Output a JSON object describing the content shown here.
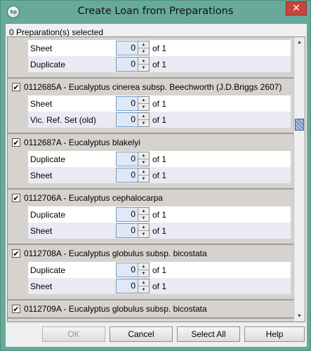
{
  "window": {
    "title": "Create Loan from Preparations",
    "app_icon_text": "Sp",
    "close_glyph": "✕"
  },
  "status": {
    "selected_text": "0 Preparation(s) selected"
  },
  "groups": [
    {
      "checked": true,
      "label": "",
      "rows": [
        {
          "type": "Sheet",
          "value": "0",
          "of": "of 1"
        },
        {
          "type": "Duplicate",
          "value": "0",
          "of": "of 1"
        }
      ]
    },
    {
      "checked": true,
      "label": "0112685A - Eucalyptus cinerea subsp. Beechworth (J.D.Briggs 2607)",
      "rows": [
        {
          "type": "Sheet",
          "value": "0",
          "of": "of 1"
        },
        {
          "type": "Vic. Ref. Set (old)",
          "value": "0",
          "of": "of 1"
        }
      ]
    },
    {
      "checked": true,
      "label": "0112687A - Eucalyptus blakelyi",
      "rows": [
        {
          "type": "Duplicate",
          "value": "0",
          "of": "of 1"
        },
        {
          "type": "Sheet",
          "value": "0",
          "of": "of 1"
        }
      ]
    },
    {
      "checked": true,
      "label": "0112706A - Eucalyptus cephalocarpa",
      "rows": [
        {
          "type": "Duplicate",
          "value": "0",
          "of": "of 1"
        },
        {
          "type": "Sheet",
          "value": "0",
          "of": "of 1"
        }
      ]
    },
    {
      "checked": true,
      "label": "0112708A - Eucalyptus globulus subsp. bicostata",
      "rows": [
        {
          "type": "Duplicate",
          "value": "0",
          "of": "of 1"
        },
        {
          "type": "Sheet",
          "value": "0",
          "of": "of 1"
        }
      ]
    },
    {
      "checked": true,
      "label": "0112709A - Eucalyptus globulus subsp. bicostata",
      "rows": []
    }
  ],
  "buttons": {
    "ok": "OK",
    "cancel": "Cancel",
    "select_all": "Select All",
    "help": "Help"
  },
  "colors": {
    "titlebar": "#67aa9a",
    "close": "#c7463b",
    "row_alt": "#eaeaf4",
    "spinner_field": "#dfe8f6"
  }
}
